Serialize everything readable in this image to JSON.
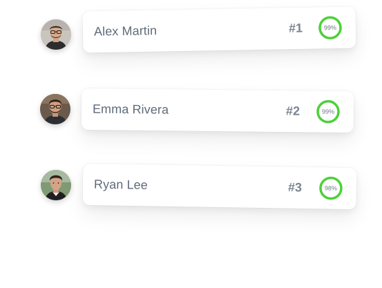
{
  "colors": {
    "accent": "#4cd137",
    "track": "#e3e7ea",
    "name_text": "#5f6b78",
    "rank_text": "#7a8593"
  },
  "leaderboard": [
    {
      "name": "Alex Martin",
      "rank": "#1",
      "score_label": "99%",
      "score": 0.99,
      "avatar": "avatar-alex"
    },
    {
      "name": "Emma Rivera",
      "rank": "#2",
      "score_label": "99%",
      "score": 0.99,
      "avatar": "avatar-emma"
    },
    {
      "name": "Ryan Lee",
      "rank": "#3",
      "score_label": "98%",
      "score": 0.98,
      "avatar": "avatar-ryan"
    }
  ]
}
